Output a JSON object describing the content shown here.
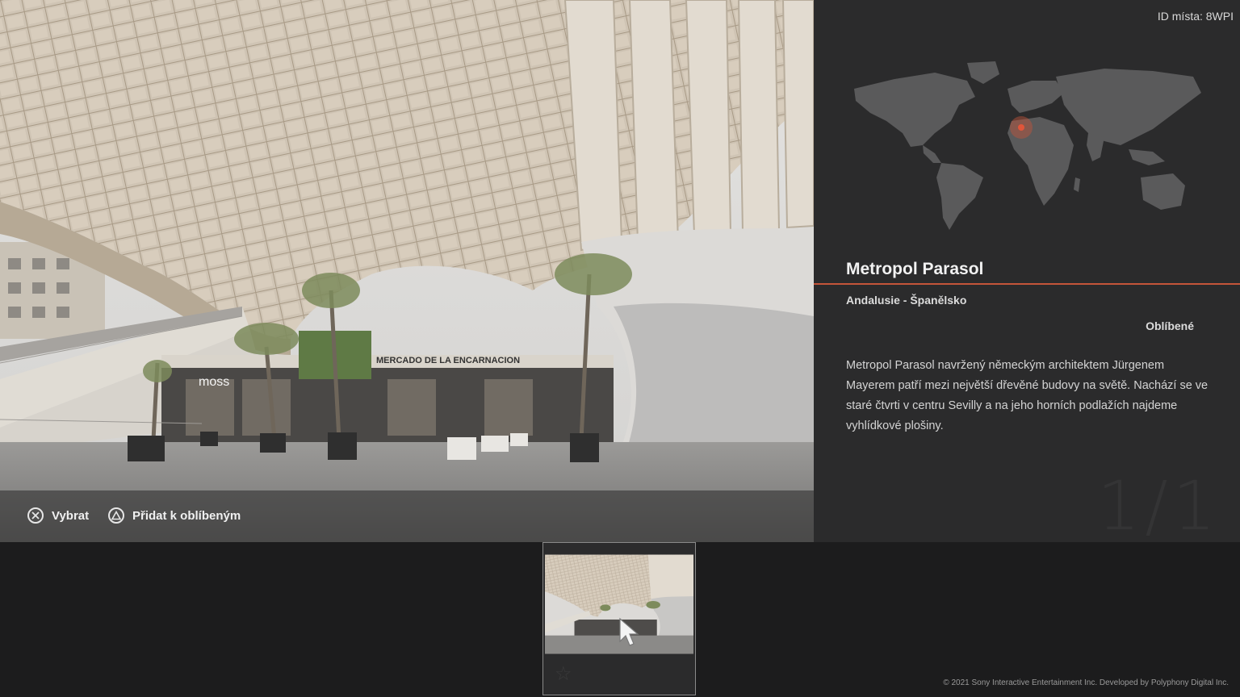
{
  "place": {
    "id_label": "ID místa: 8WPI",
    "name": "Metropol Parasol",
    "region": "Andalusie - Španělsko",
    "favorite_label": "Oblíbené",
    "description": "Metropol Parasol navržený německým architektem Jürgenem Mayerem patří mezi největší dřevěné budovy na světě. Nachází se ve staré čtvrti v centru Sevilly a na jeho horních podlažích najdeme vyhlídkové plošiny.",
    "page_counter": "1/1"
  },
  "photo_signs": {
    "store": "moss",
    "market": "MERCADO DE LA ENCARNACION"
  },
  "controls": {
    "select_label": "Vybrat",
    "add_favorite_label": "Přidat k oblíbeným"
  },
  "footer": {
    "copyright": "© 2021 Sony Interactive Entertainment Inc. Developed by Polyphony Digital Inc."
  },
  "colors": {
    "accent": "#c4553a",
    "panel": "#2b2b2c",
    "strip": "#1c1c1d"
  }
}
